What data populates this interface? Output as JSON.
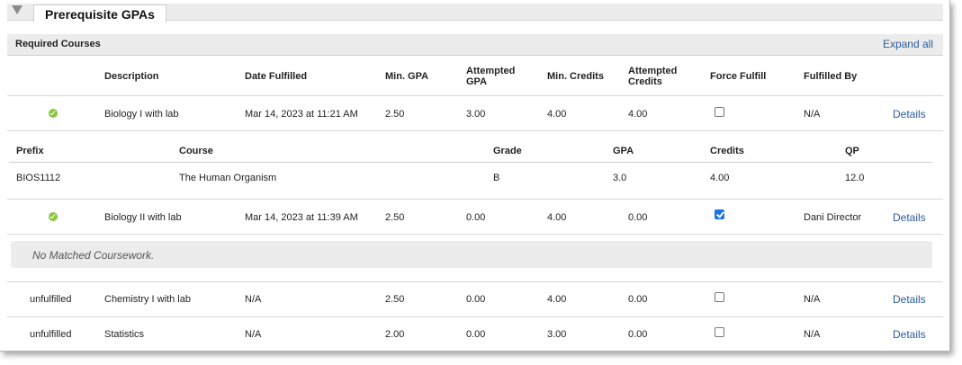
{
  "tab": {
    "label": "Prerequisite GPAs"
  },
  "section": {
    "title": "Required Courses",
    "expand_label": "Expand all"
  },
  "columns": {
    "description": "Description",
    "date_fulfilled": "Date Fulfilled",
    "min_gpa": "Min. GPA",
    "attempted_gpa_1": "Attempted",
    "attempted_gpa_2": "GPA",
    "min_credits": "Min. Credits",
    "attempted_credits_1": "Attempted",
    "attempted_credits_2": "Credits",
    "force_fulfill": "Force Fulfill",
    "fulfilled_by": "Fulfilled By"
  },
  "rows": [
    {
      "status": "check-icon",
      "description": "Biology I with lab",
      "date": "Mar 14, 2023 at 11:21 AM",
      "min_gpa": "2.50",
      "att_gpa": "3.00",
      "min_credits": "4.00",
      "att_credits": "4.00",
      "force": false,
      "fulfilled_by": "N/A",
      "details": "Details"
    },
    {
      "status": "check-icon",
      "description": "Biology II with lab",
      "date": "Mar 14, 2023 at 11:39 AM",
      "min_gpa": "2.50",
      "att_gpa": "0.00",
      "min_credits": "4.00",
      "att_credits": "0.00",
      "force": true,
      "fulfilled_by": "Dani Director",
      "details": "Details"
    },
    {
      "status": "unfulfilled",
      "description": "Chemistry I with lab",
      "date": "N/A",
      "min_gpa": "2.50",
      "att_gpa": "0.00",
      "min_credits": "4.00",
      "att_credits": "0.00",
      "force": false,
      "fulfilled_by": "N/A",
      "details": "Details"
    },
    {
      "status": "unfulfilled",
      "description": "Statistics",
      "date": "N/A",
      "min_gpa": "2.00",
      "att_gpa": "0.00",
      "min_credits": "3.00",
      "att_credits": "0.00",
      "force": false,
      "fulfilled_by": "N/A",
      "details": "Details"
    }
  ],
  "coursework": {
    "headers": {
      "prefix": "Prefix",
      "course": "Course",
      "grade": "Grade",
      "gpa": "GPA",
      "credits": "Credits",
      "qp": "QP"
    },
    "items": [
      {
        "prefix": "BIOS1112",
        "course": "The Human Organism",
        "grade": "B",
        "gpa": "3.0",
        "credits": "4.00",
        "qp": "12.0"
      }
    ]
  },
  "no_match_text": "No Matched Coursework.",
  "colors": {
    "accent_link": "#2b5b9a",
    "check_green": "#8cc63f",
    "checkbox_checked": "#1a73e8"
  }
}
